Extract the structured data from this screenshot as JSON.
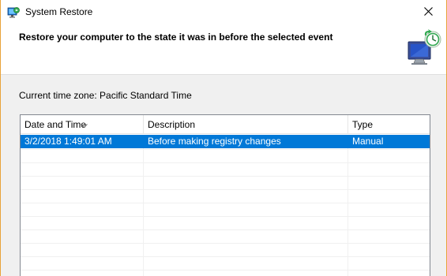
{
  "window": {
    "title": "System Restore",
    "app_icon": "system-restore-icon",
    "close_icon": "close-icon"
  },
  "header": {
    "heading": "Restore your computer to the state it was in before the selected event",
    "icon": "system-restore-monitor-icon"
  },
  "timezone_label": "Current time zone: Pacific Standard Time",
  "restore_points": {
    "columns": [
      {
        "label": "Date and Time",
        "sorted": "descending"
      },
      {
        "label": "Description"
      },
      {
        "label": "Type"
      }
    ],
    "rows": [
      {
        "date_time": "3/2/2018 1:49:01 AM",
        "description": "Before making registry changes",
        "type": "Manual",
        "selected": true
      }
    ]
  },
  "colors": {
    "selection": "#0078d7",
    "border_accent": "#e8a33a"
  }
}
